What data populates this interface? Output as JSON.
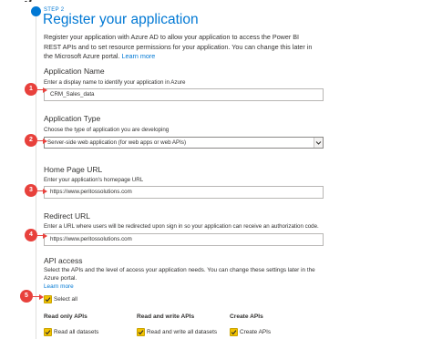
{
  "header": {
    "cut_title": "g",
    "step_label": "STEP 2",
    "title": "Register your application",
    "intro_text": "Register your application with Azure AD to allow your application to access the Power BI REST APIs and to set resource permissions for your application. You can change this later in the Microsoft Azure portal.",
    "learn_more": "Learn more"
  },
  "app_name": {
    "heading": "Application Name",
    "hint": "Enter a display name to identify your application in Azure",
    "value": "CRM_Sales_data"
  },
  "app_type": {
    "heading": "Application Type",
    "hint": "Choose the type of application you are developing",
    "selected": "Server-side web application (for web apps or web APIs)"
  },
  "home_url": {
    "heading": "Home Page URL",
    "hint": "Enter your application's homepage URL",
    "value": "https://www.peritossolutions.com"
  },
  "redirect_url": {
    "heading": "Redirect URL",
    "hint": "Enter a URL where users will be redirected upon sign in so your application can receive an authorization code.",
    "value": "https://www.peritossolutions.com"
  },
  "api_access": {
    "heading": "API access",
    "text": "Select the APIs and the level of access your application needs. You can change these settings later in the Azure portal.",
    "learn_more": "Learn more",
    "select_all": "Select all",
    "columns": [
      {
        "title": "Read only APIs",
        "item": "Read all datasets"
      },
      {
        "title": "Read and write APIs",
        "item": "Read and write all datasets"
      },
      {
        "title": "Create APIs",
        "item": "Create APIs"
      }
    ]
  },
  "markers": [
    "1",
    "2",
    "3",
    "4",
    "5"
  ],
  "colors": {
    "accent": "#0078d4",
    "marker": "#e8413c",
    "checkbox": "#f2c200"
  }
}
